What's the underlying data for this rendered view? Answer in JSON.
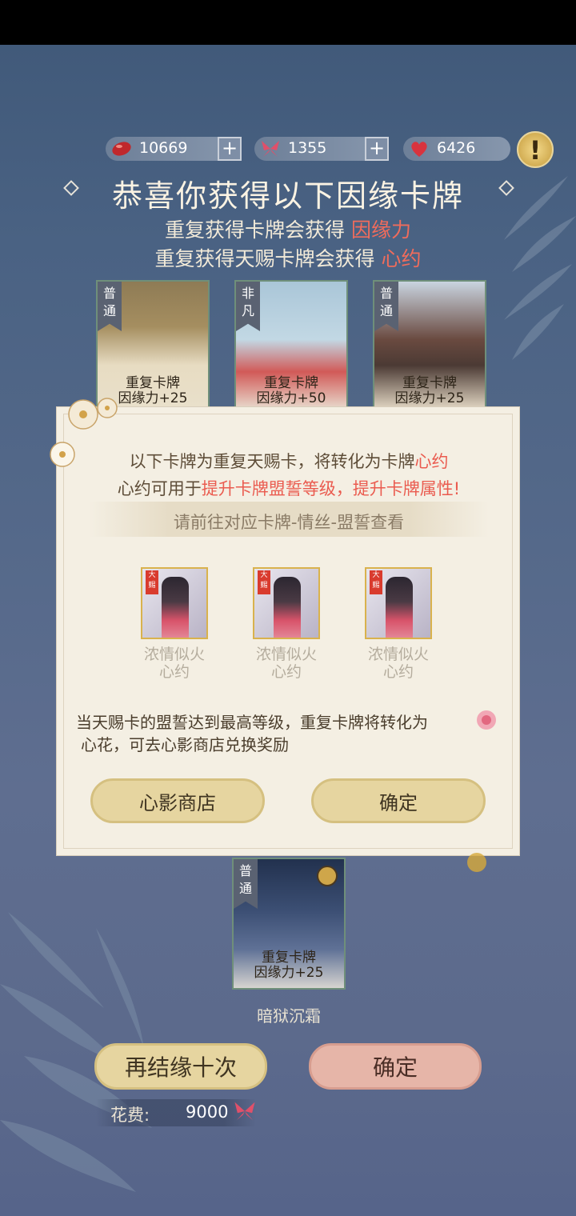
{
  "currencies": [
    {
      "icon": "red-bean-icon",
      "value": "10669",
      "has_plus": true
    },
    {
      "icon": "butterfly-icon",
      "value": "1355",
      "has_plus": true
    },
    {
      "icon": "heart-icon",
      "value": "6426",
      "has_plus": false
    }
  ],
  "alert_label": "!",
  "title": "恭喜你获得以下因缘卡牌",
  "subtitle1": {
    "text": "重复获得卡牌会获得 ",
    "highlight": "因缘力"
  },
  "subtitle2": {
    "text": "重复获得天赐卡牌会获得 ",
    "highlight": "心约"
  },
  "cards": [
    {
      "rank": "普通",
      "line1": "重复卡牌",
      "line2": "因缘力+25"
    },
    {
      "rank": "非凡",
      "line1": "重复卡牌",
      "line2": "因缘力+50"
    },
    {
      "rank": "普通",
      "line1": "重复卡牌",
      "line2": "因缘力+25"
    }
  ],
  "bottom_card": {
    "rank": "普通",
    "line1": "重复卡牌",
    "line2": "因缘力+25",
    "name": "暗狱沉霜"
  },
  "popup": {
    "line1_pre": "以下卡牌为重复天赐卡，将转化为卡牌",
    "line1_red": "心约",
    "line2_pre": "心约可用于",
    "line2_red": "提升卡牌盟誓等级，提升卡牌属性!",
    "hint": "请前往对应卡牌-情丝-盟誓查看",
    "items": [
      {
        "badge": "大赐",
        "line1": "浓情似火",
        "line2": "心约"
      },
      {
        "badge": "大赐",
        "line1": "浓情似火",
        "line2": "心约"
      },
      {
        "badge": "大赐",
        "line1": "浓情似火",
        "line2": "心约"
      }
    ],
    "note1": "当天赐卡的盟誓达到最高等级，重复卡牌将转化为",
    "note2": "心花，可去心影商店兑换奖励",
    "shop_button": "心影商店",
    "confirm_button": "确定"
  },
  "again_button": "再结缘十次",
  "confirm_button": "确定",
  "cost_label": "花费:",
  "cost_value": "9000",
  "colors": {
    "accent_red": "#ea5b4f",
    "gold": "#e6d5a0",
    "pink": "#e6b5a8"
  }
}
